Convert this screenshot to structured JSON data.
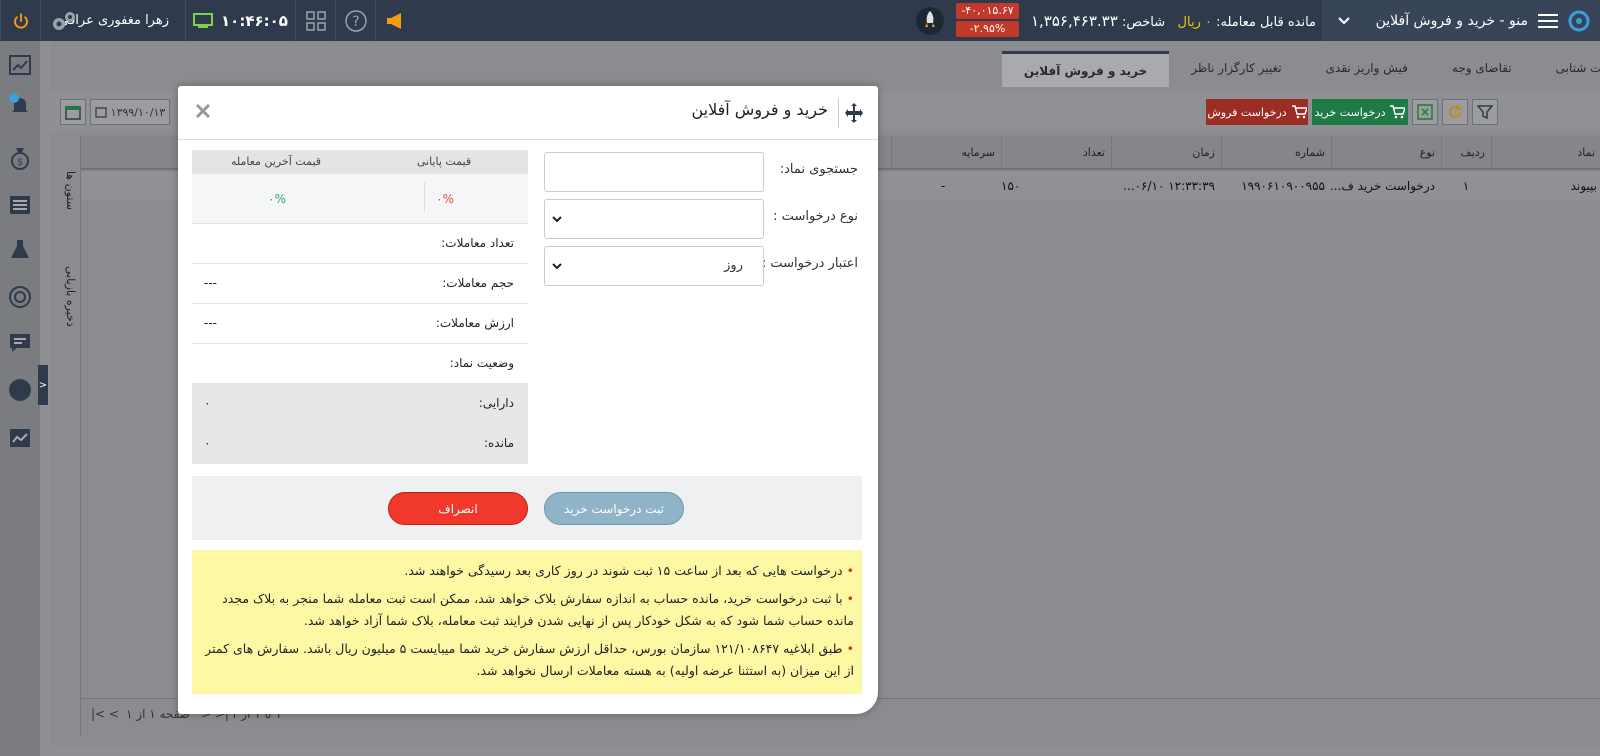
{
  "topbar": {
    "menu_title": "منو - خرید و فروش آفلاین",
    "balance_label": "مانده قابل معامله: ",
    "balance_value": "۰ ریال",
    "index_label": "شاخص: ",
    "index_value": "۱,۳۵۶,۴۶۳.۳۳",
    "index_change": "-۴۰,۰۱۵.۶۷",
    "index_percent": "-۲.۹۵%",
    "clock": "۱۰:۴۶:۰۵",
    "user_name": "زهرا مغفوری عراقی"
  },
  "tabs": [
    {
      "label": "پرداخت شتابی",
      "active": false
    },
    {
      "label": "تقاضای وجه",
      "active": false
    },
    {
      "label": "فیش واریز نقدی",
      "active": false
    },
    {
      "label": "تغییر کارگزار ناظر",
      "active": false
    },
    {
      "label": "خرید و فروش آفلاین",
      "active": true
    }
  ],
  "toolbar": {
    "buy_request": "درخواست خرید",
    "sell_request": "درخواست فروش",
    "date": "۱۳۹۹/۱۰/۱۳"
  },
  "grid": {
    "columns": [
      "نماد",
      "ردیف",
      "نوع",
      "شماره",
      "زمان",
      "تعداد",
      "سرمایه"
    ],
    "row": {
      "symbol": "بپیوند",
      "index": "۱",
      "type": "درخواست خرید ف...",
      "number": "۱۹۹۰۶۱۰۹۰۰۹۵۵",
      "time": "۱۲:۳۳:۳۹ ۰۶/۱۰...",
      "count": "۱۵۰",
      "capital": "-"
    },
    "footer_range": "۱ تا ۱ از ۱",
    "footer_page": "صفحه ۱ از ۱",
    "side_columns": "ستون ها",
    "side_save": "ذخیره بازیابی"
  },
  "modal": {
    "title": "خرید و فروش آفلاین",
    "symbol_search_label": "جستجوی نماد:",
    "symbol_search_value": "",
    "request_type_label": "نوع درخواست :",
    "request_type_value": "",
    "validity_label": "اعتبار درخواست :",
    "validity_value": "روز",
    "info": {
      "final_price_label": "قیمت پایانی",
      "last_price_label": "قیمت آخرین معامله",
      "final_percent": "۰%",
      "last_percent": "۰%",
      "rows": [
        {
          "label": "تعداد معاملات:",
          "value": ""
        },
        {
          "label": "حجم معاملات:",
          "value": "---"
        },
        {
          "label": "ارزش معاملات:",
          "value": "---"
        },
        {
          "label": "وضعیت نماد:",
          "value": ""
        },
        {
          "label": "دارایی:",
          "value": "۰"
        },
        {
          "label": "مانده:",
          "value": "۰"
        }
      ]
    },
    "submit_button": "ثبت درخواست خرید",
    "cancel_button": "انصراف",
    "notices": [
      "درخواست هایی که بعد از ساعت ۱۵ ثبت شوند در روز کاری بعد رسیدگی خواهند شد.",
      "با ثبت درخواست خرید، مانده حساب به اندازه سفارش بلاک خواهد شد، ممکن است ثبت معامله شما منجر به بلاک مجدد مانده حساب شما شود که به شکل خودکار پس از نهایی شدن فرایند ثبت معامله، بلاک شما آزاد خواهد شد.",
      "طبق ابلاغیه ۱۲۱/۱۰۸۶۴۷ سازمان بورس، حداقل ارزش سفارش خرید شما میبایست ۵ میلیون ریال باشد. سفارش های کمتر از این میزان (به استثنا عرضه اولیه) به هسته معاملات ارسال نخواهد شد."
    ]
  },
  "colors": {
    "topbar": "#2f3b4d",
    "buy": "#27ae60",
    "sell": "#c0392b",
    "submit": "#8fb4c8",
    "cancel": "#f0392b",
    "notice": "#fdf8a3"
  }
}
